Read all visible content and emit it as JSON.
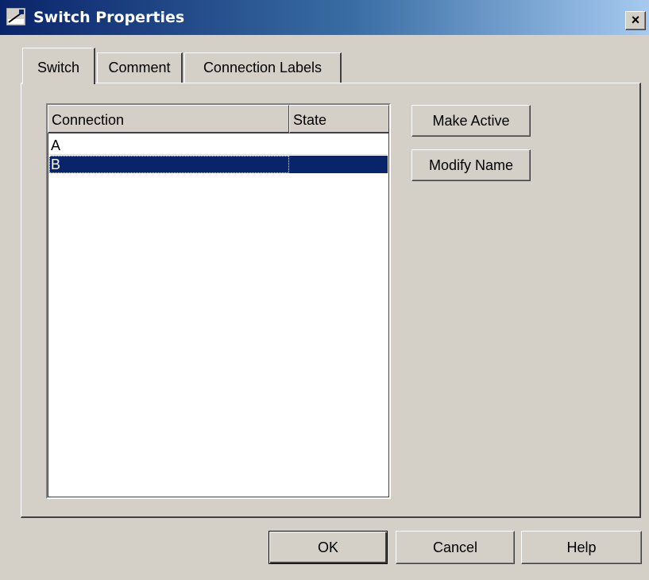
{
  "window": {
    "title": "Switch Properties",
    "close_glyph": "×",
    "icon": "switch-properties-icon",
    "title_bar_color": "#0a246a"
  },
  "tabs": [
    {
      "label": "Switch",
      "active": true
    },
    {
      "label": "Comment",
      "active": false
    },
    {
      "label": "Connection Labels",
      "active": false
    }
  ],
  "list": {
    "columns": [
      "Connection",
      "State"
    ],
    "rows": [
      {
        "connection": "A",
        "state": "",
        "selected": false
      },
      {
        "connection": "B",
        "state": "",
        "selected": true
      }
    ],
    "selection_color": "#0a246a"
  },
  "side_buttons": {
    "make_active": "Make Active",
    "modify_name": "Modify Name"
  },
  "footer_buttons": {
    "ok": "OK",
    "cancel": "Cancel",
    "help": "Help"
  }
}
